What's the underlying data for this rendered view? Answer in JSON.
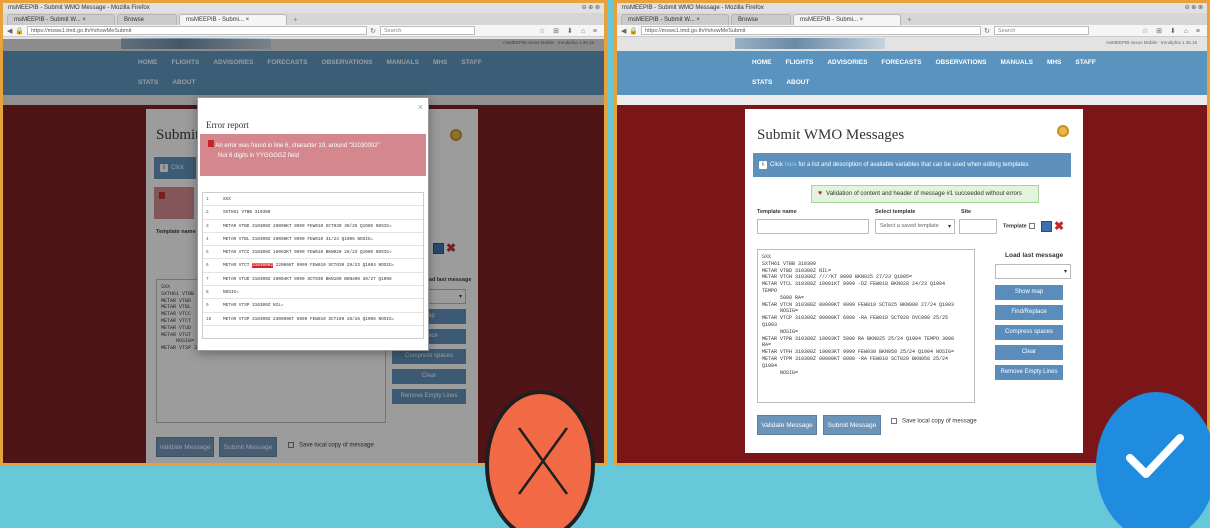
{
  "left": {
    "window_title": "msMEEPIB - Submit WMO Message - Mozilla Firefox",
    "window_controls": "⊖ ⊕ ⊗",
    "tabs": [
      "msMEEPIB - Submit W... ×",
      "Browse",
      "msMEEPIB - Submi... ×"
    ],
    "new_tab": "+",
    "url": "https://msws1.tmd.go.th/#showMeSubmit",
    "search_placeholder": "Search",
    "toolbar_icons": "☆ ⊞ ⬇ ⌂ ≡",
    "site_subtitle": "msMEEPIB nexus Mobile  ·  trendiphia 1.35.16",
    "nav_row1": [
      "HOME",
      "FLIGHTS",
      "ADVISORIES",
      "FORECASTS",
      "OBSERVATIONS",
      "MANUALS",
      "MHS",
      "STAFF"
    ],
    "nav_row2": [
      "STATS",
      "ABOUT"
    ],
    "card_title": "Submit W",
    "info_prefix": "Click",
    "template_label": "Template name",
    "load_label": "load last message",
    "side_buttons": [
      "map",
      "eplace",
      "Compress spaces",
      "Clear",
      "Remove Empty Lines"
    ],
    "textarea_text": "SXX\nSXTH61 VTBB\nMETAR VTBD\nMETAR VTBL\nMETAR VTCC\nMETAR VTCT\nMETAR VTUD\nMETAR VTUT\n     NOSIG=\nMETAR VTSP 310300Z 230090KT 9999 FEW010 SCT100 28/26 Q1008 NOSIG=",
    "validate_label": "Validate Message",
    "submit_label": "Submit Message",
    "save_copy_label": "Save local copy of message",
    "modal": {
      "title": "Error report",
      "close": "×",
      "error_line1": "An error was found in line 6, character 19, around \"31030002\"",
      "error_line2": "Not 6 digits in YYGGGGZ field",
      "rows": [
        {
          "n": "1",
          "pre": "SXX",
          "hl": "",
          "post": ""
        },
        {
          "n": "2",
          "pre": "SXTH61 VTBB 310300",
          "hl": "",
          "post": ""
        },
        {
          "n": "3",
          "pre": "METAR VTBD 310300Z 20008KT 9999 FEW010 SCT030 30/25 Q1005 NOSIG=",
          "hl": "",
          "post": ""
        },
        {
          "n": "4",
          "pre": "METAR VTBL 310300Z 20008KT 9999 FEW010 31/24 Q1006 NOSIG=",
          "hl": "",
          "post": ""
        },
        {
          "n": "5",
          "pre": "METAR VTCC 310300Z 18003KT 9999 FEW010 BKN020 28/23 Q1005 NOSIG=",
          "hl": "",
          "post": ""
        },
        {
          "n": "6",
          "pre": "METAR VTCT ",
          "hl": "31030002",
          "post": " 22006KT 9999 FEW010 SCT030 29/23 Q1004 NOSIG="
        },
        {
          "n": "7",
          "pre": "METAR VTUD 310300Z 20004KT 9999 SCT030 BKN100 BKN400 30/27 Q1008",
          "hl": "",
          "post": ""
        },
        {
          "n": "8",
          "pre": "NOSIG=",
          "hl": "",
          "post": ""
        },
        {
          "n": "9",
          "pre": "METAR VTSP 310300Z NIL=",
          "hl": "",
          "post": ""
        },
        {
          "n": "10",
          "pre": "METAR VTSP 310300Z 230090KT 9999 FEW010 SCT100 28/26 Q1008 NOSIG=",
          "hl": "",
          "post": ""
        }
      ]
    }
  },
  "right": {
    "window_title": "msMEEPIB - Submit WMO Message - Mozilla Firefox",
    "window_controls": "⊖ ⊕ ⊗",
    "tabs": [
      "msMEEPIB - Submit W... ×",
      "Browse",
      "msMEEPIB - Submi... ×"
    ],
    "new_tab": "+",
    "url": "https://msws1.tmd.go.th/#showMeSubmit",
    "search_placeholder": "Search",
    "toolbar_icons": "☆ ⊞ ⬇ ⌂ ≡",
    "site_subtitle": "msMEEPIB nexus Mobile  ·  trendiphia 1.35.16",
    "nav_row1": [
      "HOME",
      "FLIGHTS",
      "ADVISORIES",
      "FORECASTS",
      "OBSERVATIONS",
      "MANUALS",
      "MHS",
      "STAFF"
    ],
    "nav_row2": [
      "STATS",
      "ABOUT"
    ],
    "card_title": "Submit WMO Messages",
    "info_text": "for a list and description of available variables that can be used when editing templates",
    "info_prefix": "Click",
    "info_link": "here",
    "success_text": "Validation of content and header of message #1 succeeded without errors",
    "template_name_label": "Template name",
    "select_template_label": "Select template",
    "select_template_value": "Select a saved template",
    "site_label": "Site",
    "template_checkbox_label": "Template",
    "load_label": "Load last message",
    "side_buttons": [
      "Show map",
      "Find/Replace",
      "Compress spaces",
      "Clear",
      "Remove Empty Lines"
    ],
    "textarea_text": "SXX\nSXTH61 VTBB 310300\nMETAR VTBD 310300Z NIL=\nMETAR VTCH 310300Z ////KT 9999 BKN025 27/23 Q1005=\nMETAR VTCL 310300Z 19001KT 9999 -DZ FEW018 BKN028 24/23 Q1004\nTEMPO\n      5000 RA=\nMETAR VTCN 310300Z 00000KT 9999 FEW010 SCT025 BKN080 27/24 Q1003\n      NOSIG=\nMETAR VTCP 310300Z 00000KT 6000 -RA FEW010 SCT020 OVC080 25/25\nQ1003\n      NOSIG=\nMETAR VTPB 310300Z 10003KT 5000 RA BKN025 25/24 Q1004 TEMPO 3000\nRA=\nMETAR VTPH 310300Z 19003KT 9999 FEW030 BKN050 25/24 Q1004 NOSIG=\nMETAR VTPM 310300Z 00000KT 8000 -RA FEW010 SCT020 BKN050 25/24\nQ1004\n      NOSIG=",
    "validate_label": "Validate Message",
    "submit_label": "Submit Message",
    "save_copy_label": "Save local copy of message"
  },
  "colors": {
    "accent": "#5a93bd",
    "page_bg": "#7a1518",
    "error": "#d4888d",
    "success": "#e3f3de",
    "reject": "#f26a45",
    "accept": "#1f8ce0"
  },
  "badges": {
    "reject_icon": "x-icon",
    "accept_icon": "check-icon"
  }
}
